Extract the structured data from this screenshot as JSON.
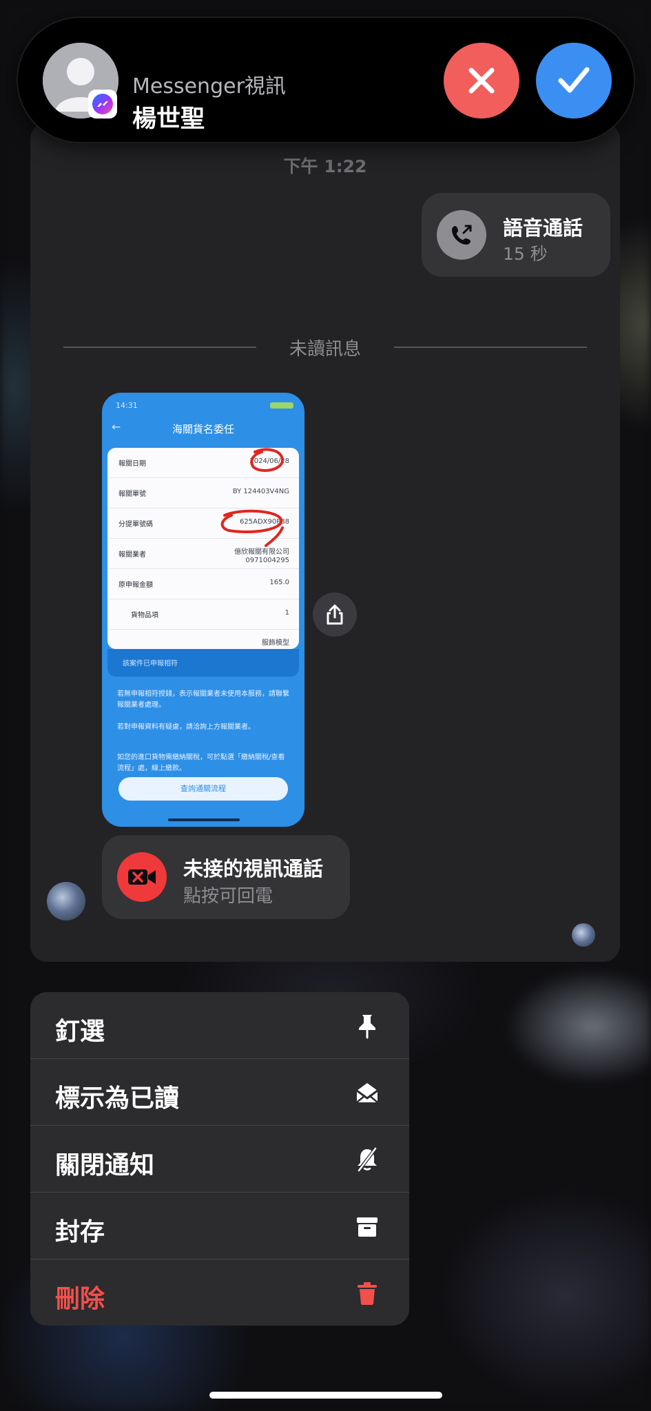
{
  "incoming_call": {
    "subtitle": "Messenger視訊",
    "caller_name": "楊世聖",
    "decline_icon": "close-icon",
    "accept_icon": "checkmark-icon",
    "colors": {
      "decline": "#f15e5c",
      "accept": "#3b8ff2"
    }
  },
  "chat": {
    "timestamp": "下午 1:22",
    "voice_call": {
      "title": "語音通話",
      "duration": "15 秒",
      "icon": "phone-outgoing-icon"
    },
    "unread_divider": "未讀訊息",
    "image_message": {
      "screen_time": "14:31",
      "screen_title": "海關貨名委任",
      "rows": [
        {
          "label": "報關日期",
          "value": "2024/06/28"
        },
        {
          "label": "報關單號",
          "value": "BY 124403V4NG"
        },
        {
          "label": "分提單號碼",
          "value": "625ADX90P88"
        },
        {
          "label": "報關業者",
          "value": "億欣報關有限公司",
          "value2": "0971004295"
        },
        {
          "label": "原申報金額",
          "value": "165.0"
        },
        {
          "label": "貨物品項",
          "value": "1"
        },
        {
          "label": "",
          "value": "服飾模型"
        }
      ],
      "band_text": "該案件已申報相符",
      "bullets": [
        "若無申報相符授錢，表示報關業者未使用本服務，請聯繫報關業者處理。",
        "若對申報資料有疑慮，請洽詢上方報關業者。",
        "如您的進口貨物需繳納關稅，可於點選「繳納關稅/查看流程」處，線上繳款。"
      ],
      "button_text": "查詢通關流程"
    },
    "share_icon": "share-icon",
    "missed_call": {
      "title": "未接的視訊通話",
      "subtitle": "點按可回電",
      "icon": "video-off-icon"
    }
  },
  "context_menu": {
    "items": [
      {
        "label": "釘選",
        "icon": "pin-icon"
      },
      {
        "label": "標示為已讀",
        "icon": "envelope-open-icon"
      },
      {
        "label": "關閉通知",
        "icon": "bell-slash-icon"
      },
      {
        "label": "封存",
        "icon": "archive-icon"
      },
      {
        "label": "刪除",
        "icon": "trash-icon",
        "destructive": true
      }
    ],
    "destructive_color": "#f2504b"
  }
}
